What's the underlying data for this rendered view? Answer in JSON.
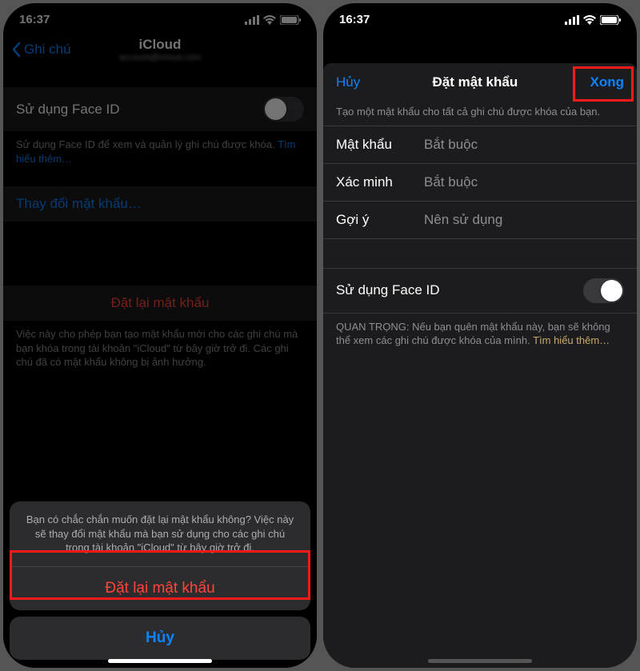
{
  "statusbar": {
    "time": "16:37"
  },
  "left": {
    "back_label": "Ghi chú",
    "title": "iCloud",
    "faceid_label": "Sử dụng Face ID",
    "faceid_desc": "Sử dụng Face ID để xem và quản lý ghi chú được khóa.",
    "learn_more": "Tìm hiểu thêm…",
    "change_password": "Thay đổi mật khẩu…",
    "reset_password_title": "Đặt lại mật khẩu",
    "reset_password_desc": "Việc này cho phép bạn tạo mật khẩu mới cho các ghi chú mà bạn khóa trong tài khoản \"iCloud\" từ bây giờ trở đi. Các ghi chú đã có mật khẩu không bị ảnh hưởng.",
    "sheet": {
      "message": "Bạn có chắc chắn muốn đặt lại mật khẩu không? Việc này sẽ thay đổi mật khẩu mà bạn sử dụng cho các ghi chú trong tài khoản \"iCloud\" từ bây giờ trở đi.",
      "destructive": "Đặt lại mật khẩu",
      "cancel": "Hủy"
    }
  },
  "right": {
    "cancel": "Hủy",
    "title": "Đặt mật khẩu",
    "done": "Xong",
    "instruction": "Tạo một mật khẩu cho tất cả ghi chú được khóa của bạn.",
    "fields": {
      "password_label": "Mật khẩu",
      "password_placeholder": "Bắt buộc",
      "verify_label": "Xác minh",
      "verify_placeholder": "Bắt buộc",
      "hint_label": "Gợi ý",
      "hint_placeholder": "Nên sử dụng"
    },
    "faceid_label": "Sử dụng Face ID",
    "important_prefix": "QUAN TRỌNG: Nếu bạn quên mật khẩu này, bạn sẽ không thể xem các ghi chú được khóa của mình.",
    "learn_more": "Tìm hiểu thêm…"
  }
}
